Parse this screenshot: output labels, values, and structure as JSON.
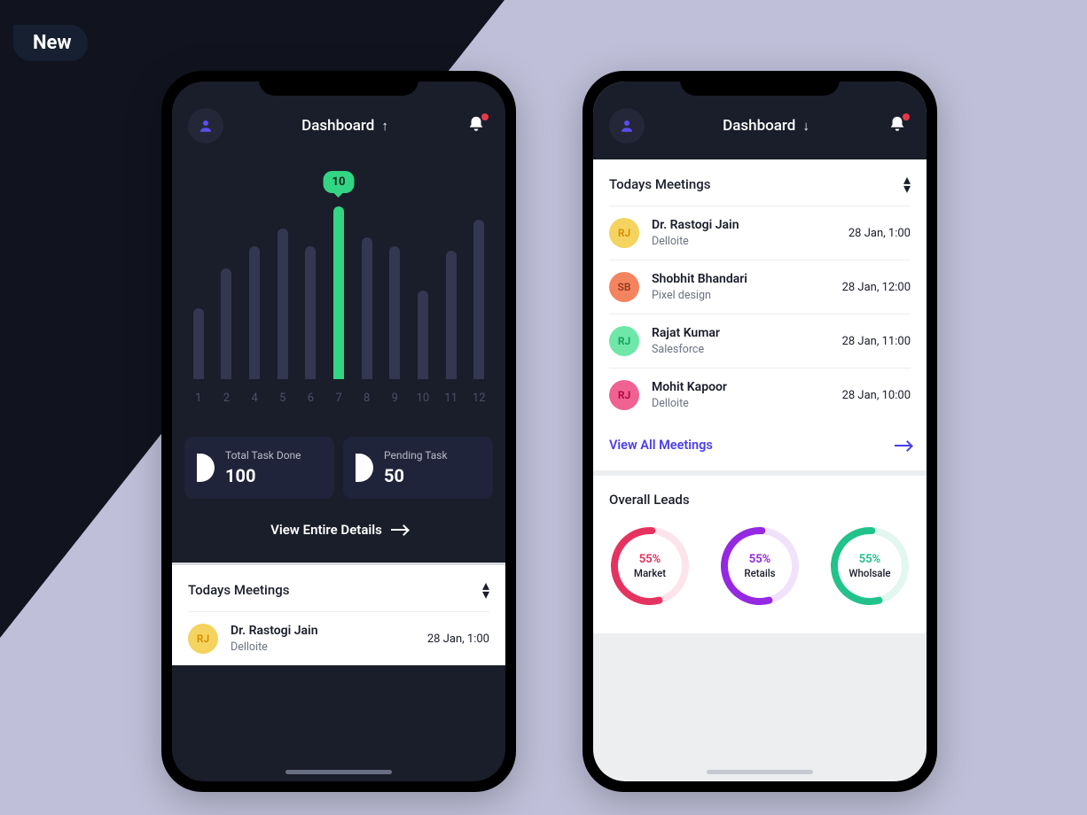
{
  "badge": "New",
  "header": {
    "title": "Dashboard"
  },
  "chart_data": {
    "type": "bar",
    "categories": [
      "1",
      "2",
      "4",
      "5",
      "6",
      "7",
      "8",
      "9",
      "10",
      "11",
      "12"
    ],
    "values": [
      80,
      125,
      150,
      170,
      150,
      195,
      160,
      150,
      100,
      145,
      180
    ],
    "active_index": 5,
    "active_pill": "10",
    "title": "",
    "xlabel": "",
    "ylabel": "",
    "ylim": [
      0,
      220
    ]
  },
  "stats": {
    "total": {
      "label": "Total Task Done",
      "value": "100"
    },
    "pending": {
      "label": "Pending Task",
      "value": "50"
    }
  },
  "view_details": "View Entire Details",
  "meetings": {
    "title": "Todays Meetings",
    "view_all": "View All Meetings",
    "items": [
      {
        "initials": "RJ",
        "color": "yellow",
        "name": "Dr. Rastogi Jain",
        "company": "Delloite",
        "time": "28 Jan, 1:00"
      },
      {
        "initials": "SB",
        "color": "orange",
        "name": "Shobhit Bhandari",
        "company": "Pixel design",
        "time": "28 Jan, 12:00"
      },
      {
        "initials": "RJ",
        "color": "green",
        "name": "Rajat Kumar",
        "company": "Salesforce",
        "time": "28 Jan, 11:00"
      },
      {
        "initials": "RJ",
        "color": "pink",
        "name": "Mohit Kapoor",
        "company": "Delloite",
        "time": "28 Jan, 10:00"
      }
    ]
  },
  "leads": {
    "title": "Overall Leads",
    "items": [
      {
        "pct": "55%",
        "label": "Market",
        "color": "#e5335f"
      },
      {
        "pct": "55%",
        "label": "Retails",
        "color": "#9528e1"
      },
      {
        "pct": "55%",
        "label": "Wholsale",
        "color": "#21c38a"
      }
    ]
  },
  "colors": {
    "accent_green": "#32d583",
    "accent_purple": "#4a3ced"
  }
}
